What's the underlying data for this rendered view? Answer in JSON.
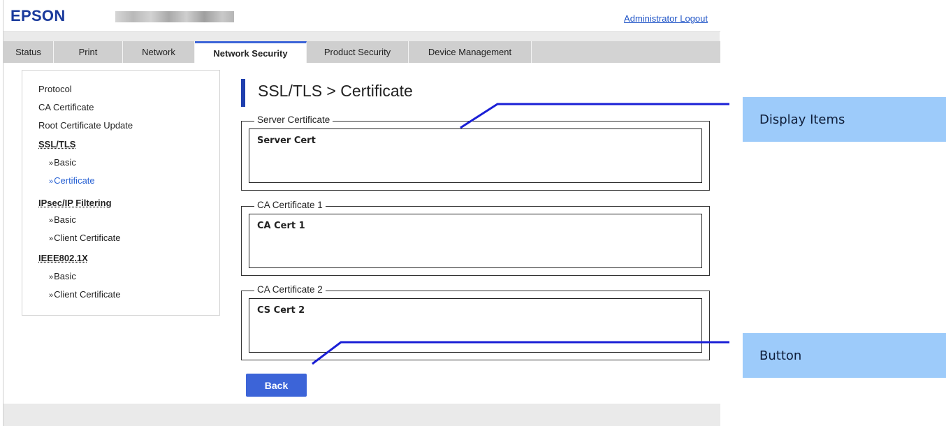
{
  "header": {
    "logo": "EPSON",
    "admin_logout": "Administrator Logout"
  },
  "tabs": [
    {
      "label": "Status",
      "active": false
    },
    {
      "label": "Print",
      "active": false
    },
    {
      "label": "Network",
      "active": false
    },
    {
      "label": "Network Security",
      "active": true
    },
    {
      "label": "Product Security",
      "active": false
    },
    {
      "label": "Device Management",
      "active": false
    }
  ],
  "sidebar": {
    "items": [
      {
        "label": "Protocol",
        "kind": "link"
      },
      {
        "label": "CA Certificate",
        "kind": "link"
      },
      {
        "label": "Root Certificate Update",
        "kind": "link"
      },
      {
        "label": "SSL/TLS",
        "kind": "heading"
      },
      {
        "label": "Basic",
        "kind": "sub"
      },
      {
        "label": "Certificate",
        "kind": "sub",
        "current": true
      },
      {
        "label": "IPsec/IP Filtering",
        "kind": "heading"
      },
      {
        "label": "Basic",
        "kind": "sub"
      },
      {
        "label": "Client Certificate",
        "kind": "sub"
      },
      {
        "label": "IEEE802.1X",
        "kind": "heading"
      },
      {
        "label": "Basic",
        "kind": "sub"
      },
      {
        "label": "Client Certificate",
        "kind": "sub"
      }
    ],
    "sub_prefix": "»"
  },
  "main": {
    "title": "SSL/TLS > Certificate",
    "groups": [
      {
        "legend": "Server Certificate",
        "value": "Server Cert"
      },
      {
        "legend": "CA Certificate 1",
        "value": "CA Cert 1"
      },
      {
        "legend": "CA Certificate 2",
        "value": "CS Cert 2"
      }
    ],
    "back_label": "Back"
  },
  "annotations": {
    "display_items": "Display Items",
    "button": "Button"
  },
  "colors": {
    "brand": "#1a3a9c",
    "accent": "#3c64d8",
    "link": "#1f54c7",
    "current_link": "#2a63d4",
    "callout_bg": "#9dcbfa",
    "leader_line": "#1a1fd6"
  }
}
